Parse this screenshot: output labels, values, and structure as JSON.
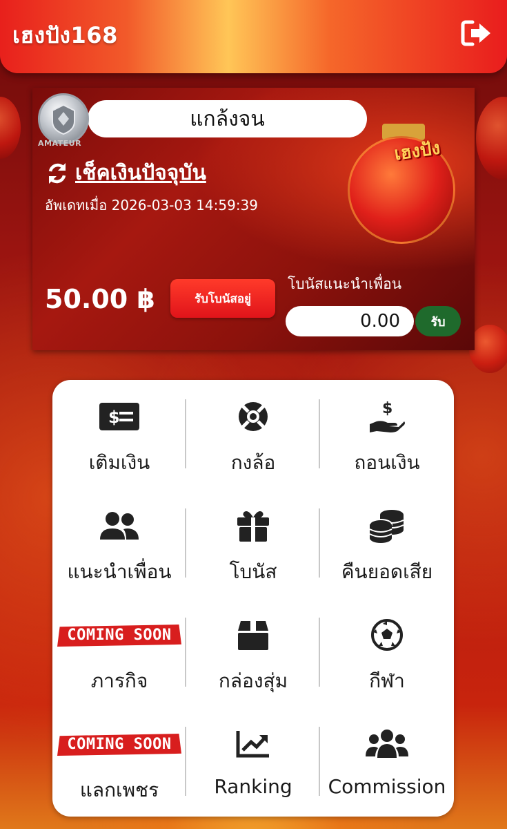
{
  "header": {
    "brand": "เฮงปัง168"
  },
  "card": {
    "rank_badge_text": "AMATEUR",
    "username": "แกล้งจน",
    "refresh_label": "เช็คเงินปัจจุบัน",
    "updated_label": "อัพเดทเมื่อ 2026-03-03 14:59:39",
    "balance": "50.00 ฿",
    "bonus_button": "รับโบนัสอยู่",
    "referral_label": "โบนัสแนะนำเพื่อน",
    "referral_amount": "0.00",
    "claim_button": "รับ"
  },
  "menu": {
    "items": [
      {
        "label": "เติมเงิน",
        "icon": "deposit-cash-icon"
      },
      {
        "label": "กงล้อ",
        "icon": "wheel-lifebuoy-icon"
      },
      {
        "label": "ถอนเงิน",
        "icon": "withdraw-hand-icon"
      },
      {
        "label": "แนะนำเพื่อน",
        "icon": "users-icon"
      },
      {
        "label": "โบนัส",
        "icon": "gift-icon"
      },
      {
        "label": "คืนยอดเสีย",
        "icon": "coins-icon"
      },
      {
        "label": "ภารกิจ",
        "icon": "coming-soon-banner",
        "badge": "COMING SOON"
      },
      {
        "label": "กล่องสุ่ม",
        "icon": "box-icon"
      },
      {
        "label": "กีฬา",
        "icon": "soccer-ball-icon"
      },
      {
        "label": "แลกเพชร",
        "icon": "coming-soon-banner",
        "badge": "COMING SOON"
      },
      {
        "label": "Ranking",
        "icon": "chart-line-icon"
      },
      {
        "label": "Commission",
        "icon": "group-icon"
      }
    ]
  }
}
